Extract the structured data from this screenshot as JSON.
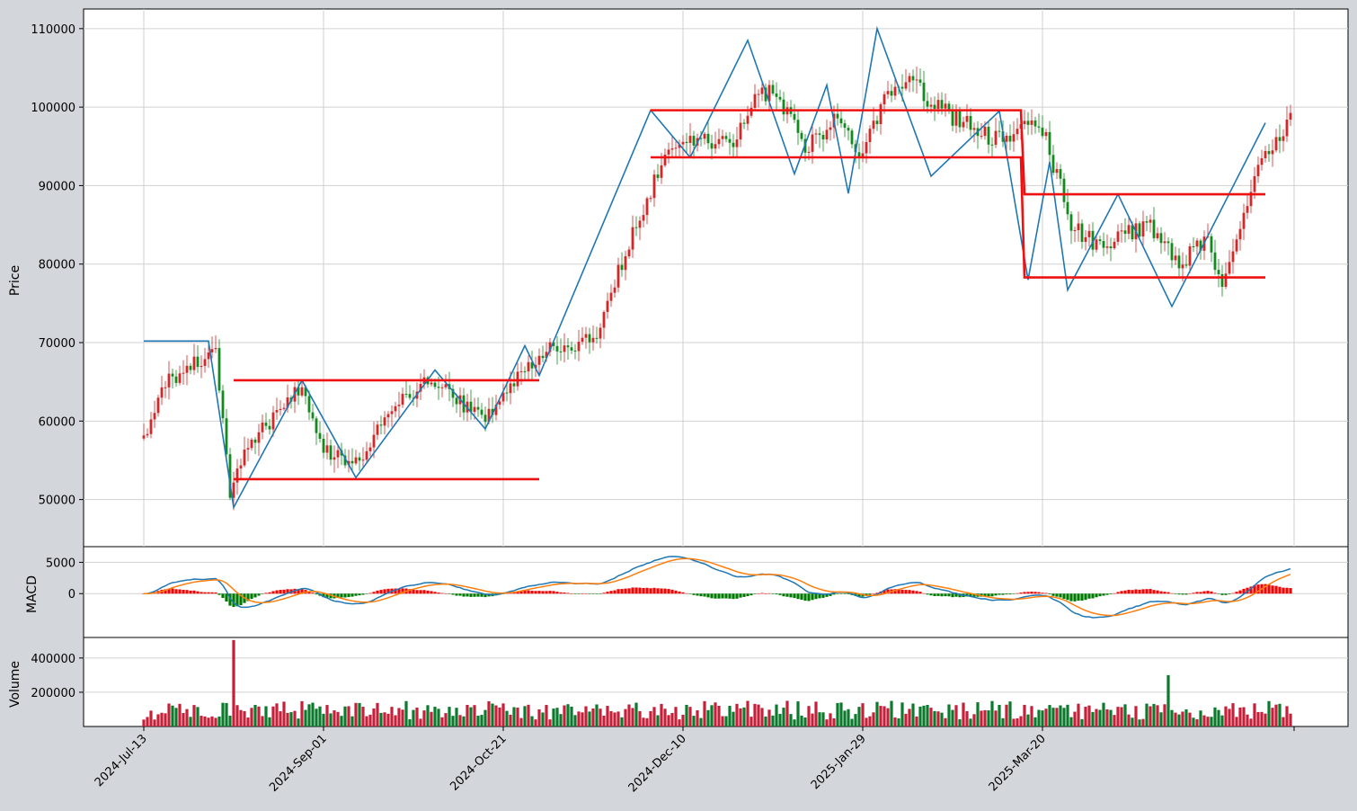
{
  "chart_data": {
    "type": "candlestick",
    "title": "",
    "x_start": "2024-07-13",
    "num_days": 320,
    "x_tick_labels": [
      "2024-Jul-13",
      "2024-Sep-01",
      "2024-Oct-21",
      "2024-Dec-10",
      "2025-Jan-29",
      "2025-Mar-20"
    ],
    "colors": {
      "up": "#d62728",
      "down": "#138a1e",
      "zigzag": "#1f77b4",
      "levels": "#ee1111",
      "signal": "#ff7f0e"
    },
    "panels": [
      {
        "id": "price",
        "ylabel": "Price",
        "yticks": [
          "50000",
          "60000",
          "70000",
          "80000",
          "90000",
          "100000",
          "110000"
        ],
        "ylim": [
          44000,
          112500
        ]
      },
      {
        "id": "macd",
        "ylabel": "MACD",
        "yticks": [
          "0",
          "5000"
        ],
        "ylim": [
          -7000,
          7500
        ]
      },
      {
        "id": "volume",
        "ylabel": "Volume",
        "yticks": [
          "200000",
          "400000"
        ],
        "ylim": [
          0,
          520000
        ]
      }
    ],
    "price_anchors": [
      [
        0,
        58000
      ],
      [
        6,
        65000
      ],
      [
        14,
        67500
      ],
      [
        20,
        68500
      ],
      [
        24,
        50000
      ],
      [
        28,
        57000
      ],
      [
        34,
        59000
      ],
      [
        44,
        64500
      ],
      [
        50,
        57000
      ],
      [
        58,
        54000
      ],
      [
        62,
        56500
      ],
      [
        72,
        63500
      ],
      [
        82,
        65000
      ],
      [
        94,
        60000
      ],
      [
        104,
        66000
      ],
      [
        112,
        69000
      ],
      [
        118,
        69500
      ],
      [
        126,
        71000
      ],
      [
        136,
        84000
      ],
      [
        146,
        95000
      ],
      [
        156,
        96000
      ],
      [
        164,
        95000
      ],
      [
        170,
        102000
      ],
      [
        176,
        101500
      ],
      [
        184,
        95000
      ],
      [
        192,
        98000
      ],
      [
        200,
        94000
      ],
      [
        206,
        100500
      ],
      [
        212,
        104000
      ],
      [
        220,
        100000
      ],
      [
        226,
        98500
      ],
      [
        236,
        96000
      ],
      [
        244,
        97000
      ],
      [
        250,
        97500
      ],
      [
        258,
        85000
      ],
      [
        266,
        82000
      ],
      [
        272,
        84000
      ],
      [
        280,
        84500
      ],
      [
        288,
        80000
      ],
      [
        296,
        83000
      ],
      [
        300,
        77000
      ],
      [
        304,
        84000
      ],
      [
        312,
        94000
      ],
      [
        318,
        97500
      ],
      [
        320,
        99500
      ]
    ],
    "zigzag": [
      [
        0,
        70200
      ],
      [
        18,
        70200
      ],
      [
        25,
        49000
      ],
      [
        44,
        65200
      ],
      [
        59,
        52800
      ],
      [
        81,
        66500
      ],
      [
        95,
        59000
      ],
      [
        106,
        69600
      ],
      [
        110,
        65800
      ],
      [
        141,
        99600
      ],
      [
        152,
        93600
      ],
      [
        168,
        108500
      ],
      [
        181,
        91500
      ],
      [
        190,
        102800
      ],
      [
        196,
        89000
      ],
      [
        204,
        110000
      ],
      [
        219,
        91200
      ],
      [
        238,
        99500
      ],
      [
        246,
        78000
      ],
      [
        252,
        93000
      ],
      [
        257,
        76700
      ],
      [
        271,
        88900
      ],
      [
        286,
        74600
      ],
      [
        312,
        98000
      ]
    ],
    "levels": [
      {
        "x": [
          25,
          110
        ],
        "y": [
          65200,
          65200
        ]
      },
      {
        "x": [
          25,
          110
        ],
        "y": [
          52600,
          52600
        ]
      },
      {
        "x": [
          141,
          244,
          245,
          312
        ],
        "y": [
          99600,
          99600,
          88900,
          88900
        ]
      },
      {
        "x": [
          141,
          244,
          245,
          312
        ],
        "y": [
          93600,
          93600,
          78300,
          78300
        ]
      }
    ]
  }
}
